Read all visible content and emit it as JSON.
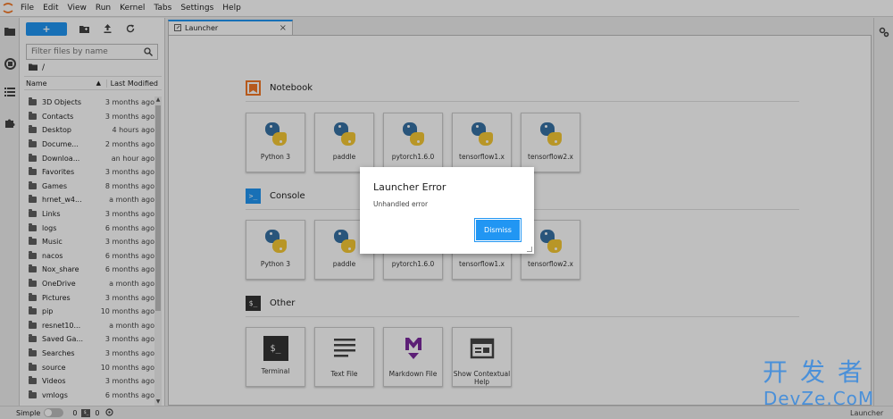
{
  "menubar": {
    "items": [
      "File",
      "Edit",
      "View",
      "Run",
      "Kernel",
      "Tabs",
      "Settings",
      "Help"
    ]
  },
  "left_strip": {
    "icons": [
      "folder-icon",
      "running-icon",
      "toc-icon",
      "extension-icon"
    ]
  },
  "filebrowser": {
    "new_label": "+",
    "search_placeholder": "Filter files by name",
    "breadcrumb": "/",
    "col_name": "Name",
    "col_modified": "Last Modified",
    "rows": [
      {
        "name": "3D Objects",
        "modified": "3 months ago"
      },
      {
        "name": "Contacts",
        "modified": "3 months ago"
      },
      {
        "name": "Desktop",
        "modified": "4 hours ago"
      },
      {
        "name": "Docume...",
        "modified": "2 months ago"
      },
      {
        "name": "Downloa...",
        "modified": "an hour ago"
      },
      {
        "name": "Favorites",
        "modified": "3 months ago"
      },
      {
        "name": "Games",
        "modified": "8 months ago"
      },
      {
        "name": "hrnet_w4...",
        "modified": "a month ago"
      },
      {
        "name": "Links",
        "modified": "3 months ago"
      },
      {
        "name": "logs",
        "modified": "6 months ago"
      },
      {
        "name": "Music",
        "modified": "3 months ago"
      },
      {
        "name": "nacos",
        "modified": "6 months ago"
      },
      {
        "name": "Nox_share",
        "modified": "6 months ago"
      },
      {
        "name": "OneDrive",
        "modified": "a month ago"
      },
      {
        "name": "Pictures",
        "modified": "3 months ago"
      },
      {
        "name": "pip",
        "modified": "10 months ago"
      },
      {
        "name": "resnet10...",
        "modified": "a month ago"
      },
      {
        "name": "Saved Ga...",
        "modified": "3 months ago"
      },
      {
        "name": "Searches",
        "modified": "3 months ago"
      },
      {
        "name": "source",
        "modified": "10 months ago"
      },
      {
        "name": "Videos",
        "modified": "3 months ago"
      },
      {
        "name": "vmlogs",
        "modified": "6 months ago"
      }
    ]
  },
  "tab": {
    "label": "Launcher",
    "close": "×"
  },
  "launcher": {
    "notebook": {
      "title": "Notebook",
      "color": "#f37726",
      "cards": [
        "Python 3",
        "paddle",
        "pytorch1.6.0",
        "tensorflow1.x",
        "tensorflow2.x"
      ]
    },
    "console": {
      "title": "Console",
      "icon_text": ">_",
      "color": "#2196f3",
      "cards": [
        "Python 3",
        "paddle",
        "pytorch1.6.0",
        "tensorflow1.x",
        "tensorflow2.x"
      ]
    },
    "other": {
      "title": "Other",
      "icon_text": "$_",
      "color": "#333333",
      "cards": [
        {
          "label": "Terminal",
          "icon": "terminal-icon"
        },
        {
          "label": "Text File",
          "icon": "text-file-icon"
        },
        {
          "label": "Markdown File",
          "icon": "markdown-icon"
        },
        {
          "label": "Show Contextual Help",
          "icon": "contextual-help-icon"
        }
      ]
    }
  },
  "statusbar": {
    "mode_label": "Simple",
    "count1": "0",
    "count2": "0",
    "right_label": "Launcher"
  },
  "dialog": {
    "title": "Launcher Error",
    "body": "Unhandled error",
    "button": "Dismiss"
  },
  "watermark": {
    "line1": "开发者",
    "line2": "DevZe.CoM"
  },
  "colors": {
    "accent": "#2196f3",
    "jupyter_orange": "#f37726",
    "markdown_purple": "#7b2a9e"
  }
}
